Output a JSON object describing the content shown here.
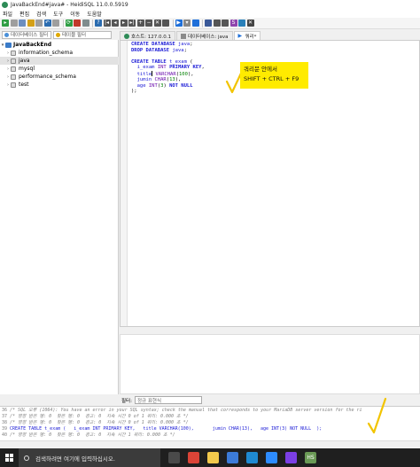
{
  "window": {
    "title": "JavaBackEnd#java# - HeidiSQL 11.0.0.5919"
  },
  "menu": [
    "파일",
    "편집",
    "검색",
    "도구",
    "이동",
    "도움말"
  ],
  "toolbar": {
    "icons": [
      {
        "name": "connect-icon",
        "color": "#2f9e44",
        "glyph": "▸"
      },
      {
        "name": "disconnect-icon",
        "color": "#9e9e9e",
        "glyph": ""
      },
      {
        "name": "new-icon",
        "color": "#6c8ebf",
        "glyph": ""
      },
      {
        "name": "copy-icon",
        "color": "#d4a017",
        "glyph": ""
      },
      {
        "name": "paste-icon",
        "color": "#9e9e9e",
        "glyph": ""
      },
      {
        "name": "undo-icon",
        "color": "#2b6cb0",
        "glyph": "↶"
      },
      {
        "name": "redo-icon",
        "color": "#9e9e9e",
        "glyph": ""
      },
      {
        "name": "sep",
        "color": "",
        "glyph": ""
      },
      {
        "name": "refresh-icon",
        "color": "#2f9e44",
        "glyph": "⟳"
      },
      {
        "name": "user-icon",
        "color": "#c0392b",
        "glyph": ""
      },
      {
        "name": "export-icon",
        "color": "#7f8c8d",
        "glyph": ""
      },
      {
        "name": "sep",
        "color": "",
        "glyph": ""
      },
      {
        "name": "help-icon",
        "color": "#2b6cb0",
        "glyph": "?"
      },
      {
        "name": "first-icon",
        "color": "#555555",
        "glyph": "|◂"
      },
      {
        "name": "prev-icon",
        "color": "#555555",
        "glyph": "◂"
      },
      {
        "name": "next-icon",
        "color": "#555555",
        "glyph": "▸"
      },
      {
        "name": "last-icon",
        "color": "#555555",
        "glyph": "▸|"
      },
      {
        "name": "add-row-icon",
        "color": "#555555",
        "glyph": "+"
      },
      {
        "name": "delete-row-icon",
        "color": "#555555",
        "glyph": "−"
      },
      {
        "name": "cancel-icon",
        "color": "#555555",
        "glyph": "✕"
      },
      {
        "name": "stop-icon",
        "color": "#555555",
        "glyph": ""
      },
      {
        "name": "sep",
        "color": "",
        "glyph": ""
      },
      {
        "name": "run-icon",
        "color": "#1e6fd9",
        "glyph": "▶"
      },
      {
        "name": "run-dropdown-icon",
        "color": "#888888",
        "glyph": "▾"
      },
      {
        "name": "run-line-icon",
        "color": "#1e6fd9",
        "glyph": ""
      },
      {
        "name": "sep",
        "color": "",
        "glyph": ""
      },
      {
        "name": "format-icon",
        "color": "#3b5998",
        "glyph": ""
      },
      {
        "name": "search-icon",
        "color": "#555555",
        "glyph": ""
      },
      {
        "name": "replace-icon",
        "color": "#555555",
        "glyph": ""
      },
      {
        "name": "sql-icon",
        "color": "#8e44ad",
        "glyph": "S"
      },
      {
        "name": "log-icon",
        "color": "#2980b9",
        "glyph": ""
      },
      {
        "name": "close-icon",
        "color": "#444444",
        "glyph": "✕"
      }
    ]
  },
  "filters": {
    "database_filter": "데이터베이스 필터",
    "table_filter": "테이블 필터"
  },
  "tree": {
    "server": "JavaBackEnd",
    "databases": [
      "information_schema",
      "java",
      "mysql",
      "performance_schema",
      "test"
    ],
    "selected": "java"
  },
  "tabs": [
    {
      "label": "호스트: 127.0.0.1",
      "icon": "host-icon",
      "color": "#2e8b57"
    },
    {
      "label": "데이터베이스: java",
      "icon": "database-icon",
      "color": "#8a8a8a"
    },
    {
      "label": "쿼리*",
      "icon": "query-tab-icon",
      "color": "#1e6fd9"
    }
  ],
  "editor": {
    "lines": [
      "CREATE DATABASE java;",
      "DROP DATABASE java;",
      "",
      "CREATE TABLE t_exam (",
      "  i_exam INT PRIMARY KEY,",
      "  title VARCHAR(100),",
      "  jumin CHAR(13),",
      "  age INT(3) NOT NULL",
      ");"
    ]
  },
  "annotation": {
    "line1": "쿼리문 안에서",
    "line2": "SHIFT + CTRL + F9",
    "color": "#ffeb00"
  },
  "result_filter": {
    "label": "필터:",
    "placeholder": "정규 표현식"
  },
  "log": {
    "lines": [
      {
        "num": "36",
        "text": "/* SQL 오류 (1064): You have an error in your SQL syntax; check the manual that corresponds to your MariaDB server version for the ri"
      },
      {
        "num": "37",
        "text": "/* 영향 받은 행: 0  찾은 행: 0  경고: 0  지속 시간 0 of 1 쿼리: 0.000 초 */"
      },
      {
        "num": "38",
        "text": "/* 영향 받은 행: 0  찾은 행: 0  경고: 0  지속 시간 0 of 1 쿼리: 0.000 초 */"
      },
      {
        "num": "39",
        "text": "CREATE TABLE t_exam (   i_exam INT PRIMARY KEY,   title VARCHAR(100),       jumin CHAR(13),   age INT(3) NOT NULL  );"
      },
      {
        "num": "40",
        "text": "/* 영향 받은 행: 0  찾은 행: 0  경고: 0  지속 시간 1 쿼리: 0.000 초 */"
      }
    ]
  },
  "taskbar": {
    "search_placeholder": "검색하려면 여기에 입력하십시오.",
    "apps": [
      {
        "name": "task-view-icon",
        "color": "#4a4a4a",
        "glyph": ""
      },
      {
        "name": "chrome-icon",
        "color": "#db4437",
        "glyph": ""
      },
      {
        "name": "file-explorer-icon",
        "color": "#f2c94c",
        "glyph": ""
      },
      {
        "name": "store-icon",
        "color": "#3c7bd8",
        "glyph": ""
      },
      {
        "name": "vscode-icon",
        "color": "#1f8ad2",
        "glyph": ""
      },
      {
        "name": "zoom-icon",
        "color": "#2d8cff",
        "glyph": ""
      },
      {
        "name": "browser-icon",
        "color": "#7b3fe4",
        "glyph": ""
      },
      {
        "name": "heidisql-icon",
        "color": "#6a9955",
        "glyph": "HS"
      }
    ]
  }
}
